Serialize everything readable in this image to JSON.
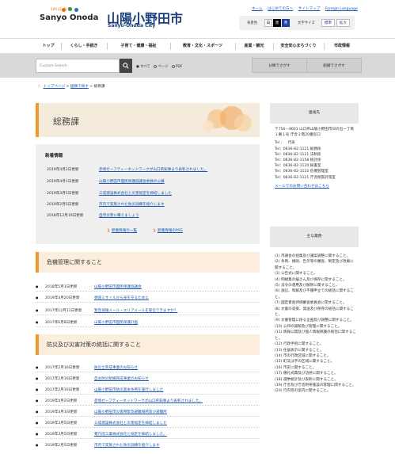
{
  "header": {
    "logo_arc_text": "SMILE CITY",
    "logo_text": "Sanyo Onoda",
    "site_title": "山陽小野田市",
    "site_subtitle": "Sanyo-Onoda City",
    "util_links": [
      "ホーム",
      "はじめての方へ",
      "サイトマップ",
      "Foreign Language"
    ],
    "bg_color_label": "背景色",
    "bg_options": [
      "白",
      "黒",
      "青"
    ],
    "font_size_label": "文字サイズ",
    "font_size_options": [
      "標準",
      "拡大"
    ]
  },
  "nav": {
    "items": [
      "トップ",
      "くらし・手続き",
      "子育て・健康・福祉",
      "教育・文化・スポーツ",
      "産業・観光",
      "安全安心まちづくり",
      "市政情報"
    ]
  },
  "search": {
    "placeholder": "Custom Search",
    "search_icon": "magnifier-icon",
    "scope_label": "すべて",
    "options": [
      "ページ",
      "PDF"
    ],
    "category_button": "分類でさがす",
    "org_button": "組織でさがす"
  },
  "breadcrumb": {
    "items": [
      "トップページ",
      "組織で探す",
      "総務課"
    ]
  },
  "page": {
    "title": "総務課"
  },
  "news": {
    "heading": "新着情報",
    "items": [
      {
        "date": "2019年4月2日更新",
        "title": "赤崎ゼーフティーネットワークが山口県知事より表彰されました。"
      },
      {
        "date": "2019年4月1日更新",
        "title": "山陽小野田市国民保護協議会委員の公募"
      },
      {
        "date": "2019年3月5日更新",
        "title": "三成建設株式会社と災害協定を締結しました"
      },
      {
        "date": "2019年2月5日更新",
        "title": "市内で実施された防災訓練を紹介します"
      },
      {
        "date": "2018年12月19日更新",
        "title": "自然災害に備えましょう"
      }
    ],
    "list_link": "新着情報の一覧",
    "rss_link": "新着情報のRSS"
  },
  "sections": [
    {
      "title": "危機管理に関すること",
      "items": [
        {
          "date": "2018年5月1日更新",
          "title": "山陽小野田市国民保護協議会"
        },
        {
          "date": "2019年4月20日更新",
          "title": "弾道ミサイルから身を守るために"
        },
        {
          "date": "2017年12月11日更新",
          "title": "緊急速報メール・エリアメールを受信できますか？"
        },
        {
          "date": "2017年6月8日更新",
          "title": "山陽小野田市国民保護計画"
        }
      ]
    },
    {
      "title": "防災及び災害対策の統括に関すること",
      "items": [
        {
          "date": "2017年2月16日更新",
          "title": "防災士育成事業のお知らせ"
        },
        {
          "date": "2017年2月16日更新",
          "title": "自主防災組織育成事業のお知らせ"
        },
        {
          "date": "2017年2月16日更新",
          "title": "山陽小野田市防災基本条例を施行しました"
        },
        {
          "date": "2019年4月2日更新",
          "title": "赤崎ゼーフティーネットワークが山口県知事より表彰されました。"
        },
        {
          "date": "2019年4月1日更新",
          "title": "山陽小野田市災害時緊急避難場所及び避難所"
        },
        {
          "date": "2019年3月5日更新",
          "title": "三成建設株式会社と災害協定を締結しました"
        },
        {
          "date": "2019年3月5日更新",
          "title": "菊乃陸工業株式会社と協定を締結しました。"
        },
        {
          "date": "2019年2月5日更新",
          "title": "市内で実施された防災訓練を紹介します"
        }
      ]
    }
  ],
  "sidebar": {
    "contact_heading": "連絡先",
    "address": "〒756－8601 山口県山陽小野田市日の出一丁目１番１号 庁舎２階20番窓口",
    "tel_rep_label": "Tel ：",
    "tel_rep": "代表",
    "phones": [
      "Tel：0836-82-1121 総務係",
      "Tel：0836-82-1121 法制係",
      "Tel：0836-82-1158 統計係",
      "Tel：0836-82-1120 秘書室",
      "Tel：0836-82-1122 危機管理室",
      "Tel：0836-82-1121 庁舎耐震対策室"
    ],
    "mail_link": "メールでのお問い合わせはこちら",
    "duties_heading": "主な業務",
    "duties": [
      "(1) 市議会の招集及び議案調整に関すること。",
      "(2) 条例、規則、告示等の審査、制定及び改廃に関すること。",
      "(3) 公告式に関すること。",
      "(4) 例規集の編さん及び保存に関すること。",
      "(5) 法令の運用及び解釈に関すること。",
      "(6) 訴訟、和解及び不服申立ての統括に関すること。",
      "(7) 固定資産評価審査委員会に関すること。",
      "(8) 文書の収受、発送及び保存の統括に関すること。",
      "(9) 文書管理に係る企画及び調整に関すること。",
      "(10) 公印の調製及び管理に関すること。",
      "(11) 情報公開及び個人情報保護の統括に関すること。",
      "(12) 行政手続に関すること。",
      "(13) 住居表示に関すること。",
      "(14) 市の行政区域に関すること。",
      "(15) 町又は字の区域に関すること。",
      "(16) 市史に関すること。",
      "(17) 儀礼式典及び功労に関すること。",
      "(18) 選挙統計及び表彰に関すること。",
      "(19) 庁舎及び庁舎附帯施設の管理に関すること。",
      "(20) 行内等の案内に関すること。"
    ]
  },
  "colors": {
    "accent_orange": "#f09a2e",
    "title_bg": "#f4ebdc",
    "link_blue": "#1a56b0",
    "site_title_navy": "#1b3f7a"
  }
}
